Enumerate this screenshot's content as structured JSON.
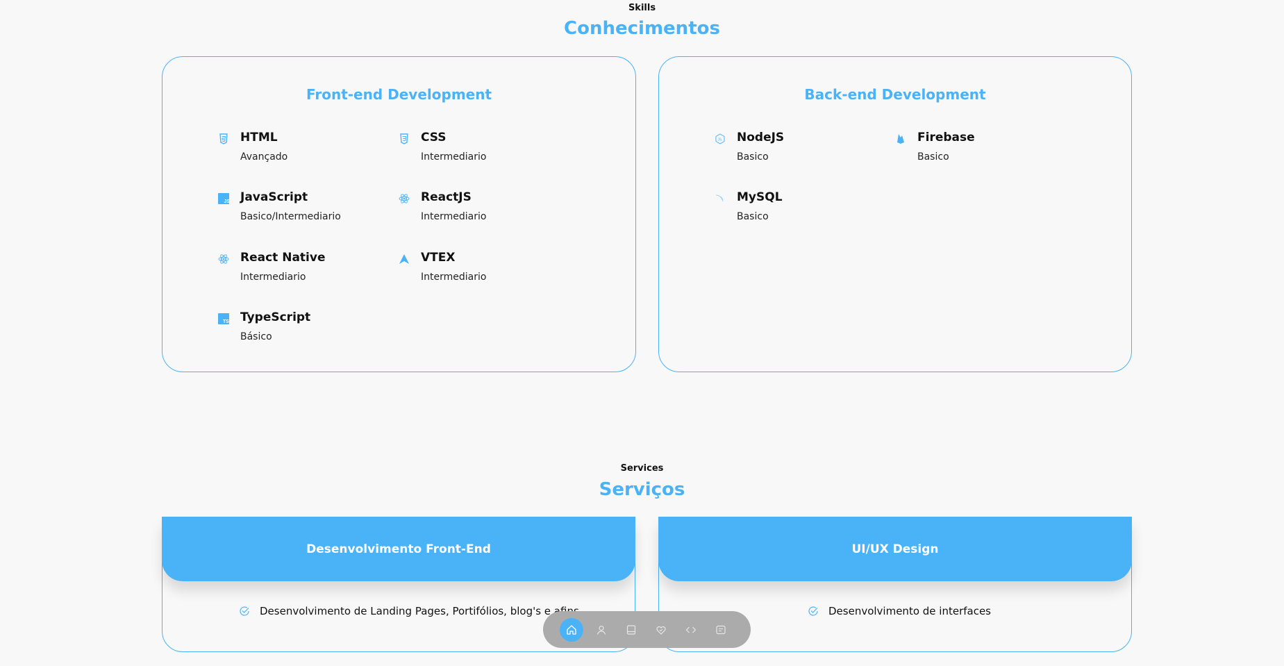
{
  "colors": {
    "accent": "#4ab3f7",
    "background": "#f8f8f8",
    "dock": "#ababab"
  },
  "skills_section": {
    "subtitle": "Skills",
    "title": "Conhecimentos",
    "frontend": {
      "title": "Front-end Development",
      "items": [
        {
          "name": "HTML",
          "level": "Avançado",
          "icon": "html5-icon"
        },
        {
          "name": "CSS",
          "level": "Intermediario",
          "icon": "css3-icon"
        },
        {
          "name": "JavaScript",
          "level": "Basico/Intermediario",
          "icon": "javascript-icon"
        },
        {
          "name": "ReactJS",
          "level": "Intermediario",
          "icon": "react-icon"
        },
        {
          "name": "React Native",
          "level": "Intermediario",
          "icon": "react-icon"
        },
        {
          "name": "VTEX",
          "level": "Intermediario",
          "icon": "vtex-icon"
        },
        {
          "name": "TypeScript",
          "level": "Básico",
          "icon": "typescript-icon"
        }
      ]
    },
    "backend": {
      "title": "Back-end Development",
      "items": [
        {
          "name": "NodeJS",
          "level": "Basico",
          "icon": "nodejs-icon"
        },
        {
          "name": "Firebase",
          "level": "Basico",
          "icon": "firebase-icon"
        },
        {
          "name": "MySQL",
          "level": "Basico",
          "icon": "mysql-icon"
        }
      ]
    }
  },
  "services_section": {
    "subtitle": "Services",
    "title": "Serviços",
    "cards": [
      {
        "title": "Desenvolvimento Front-End",
        "items": [
          "Desenvolvimento de Landing Pages, Portifólios, blog's e afins"
        ]
      },
      {
        "title": "UI/UX Design",
        "items": [
          "Desenvolvimento de interfaces"
        ]
      }
    ]
  },
  "dock": {
    "items": [
      {
        "icon": "home-icon",
        "active": true
      },
      {
        "icon": "user-icon",
        "active": false
      },
      {
        "icon": "book-icon",
        "active": false
      },
      {
        "icon": "heart-handshake-icon",
        "active": false
      },
      {
        "icon": "code-icon",
        "active": false
      },
      {
        "icon": "message-icon",
        "active": false
      }
    ]
  }
}
